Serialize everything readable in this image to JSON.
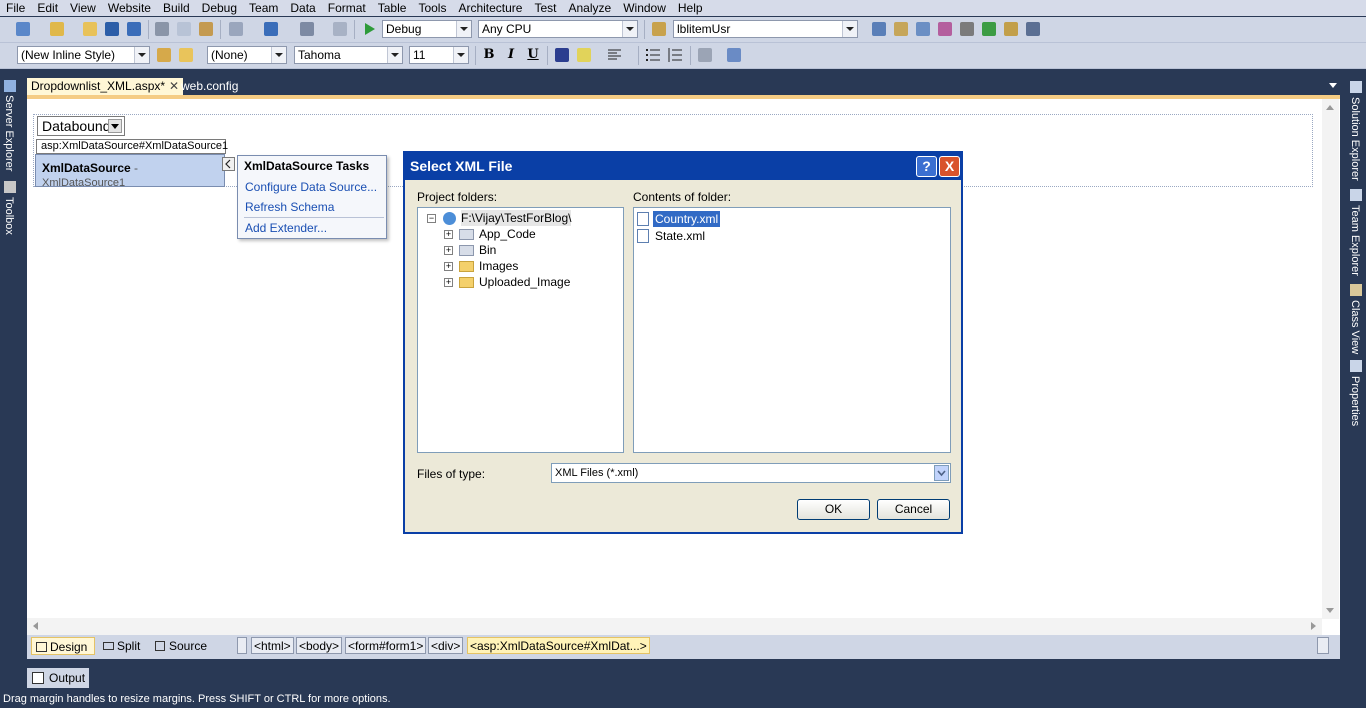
{
  "menu": [
    "File",
    "Edit",
    "View",
    "Website",
    "Build",
    "Debug",
    "Team",
    "Data",
    "Format",
    "Table",
    "Tools",
    "Architecture",
    "Test",
    "Analyze",
    "Window",
    "Help"
  ],
  "toolbar1": {
    "config": "Debug",
    "platform": "Any CPU",
    "find": "lblitemUsr"
  },
  "toolbar2": {
    "style": "(New Inline Style)",
    "target": "(None)",
    "font": "Tahoma",
    "size": "11",
    "bold": "B",
    "italic": "I",
    "underline": "U"
  },
  "left_dock": {
    "server_explorer": "Server Explorer",
    "toolbox": "Toolbox"
  },
  "right_dock": {
    "solution_explorer": "Solution Explorer",
    "team_explorer": "Team Explorer",
    "class_view": "Class View",
    "properties": "Properties"
  },
  "tabs": {
    "active": "Dropdownlist_XML.aspx*",
    "inactive": "web.config"
  },
  "designer": {
    "dropdown": "Databound",
    "control_tag": "asp:XmlDataSource#XmlDataSource1",
    "control_name": "XmlDataSource",
    "control_sep": " - ",
    "control_id": "XmlDataSource1"
  },
  "tasks": {
    "title": "XmlDataSource Tasks",
    "configure": "Configure Data Source...",
    "refresh": "Refresh Schema",
    "add_extender": "Add Extender..."
  },
  "dialog": {
    "title": "Select XML File",
    "project_label": "Project folders:",
    "contents_label": "Contents of folder:",
    "root": "F:\\Vijay\\TestForBlog\\",
    "folders": [
      "App_Code",
      "Bin",
      "Images",
      "Uploaded_Image"
    ],
    "files": [
      "Country.xml",
      "State.xml"
    ],
    "files_of_type_label": "Files of type:",
    "files_of_type": "XML Files (*.xml)",
    "ok": "OK",
    "cancel": "Cancel",
    "help_btn": "?",
    "close_btn": "X"
  },
  "viewbar": {
    "design": "Design",
    "split": "Split",
    "source": "Source",
    "crumbs": [
      "<html>",
      "<body>",
      "<form#form1>",
      "<div>",
      "<asp:XmlDataSource#XmlDat...>"
    ]
  },
  "output": "Output",
  "status": "Drag margin handles to resize margins. Press SHIFT or CTRL for more options."
}
